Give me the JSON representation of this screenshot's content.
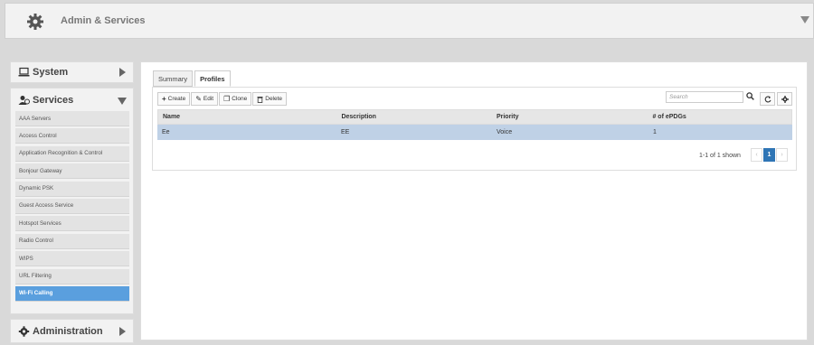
{
  "header": {
    "title": "Admin & Services",
    "icon": "gear-icon"
  },
  "sidebar": {
    "system_label": "System",
    "services_label": "Services",
    "administration_label": "Administration",
    "services_items": [
      {
        "label": "AAA Servers"
      },
      {
        "label": "Access Control"
      },
      {
        "label": "Application Recognition & Control"
      },
      {
        "label": "Bonjour Gateway"
      },
      {
        "label": "Dynamic PSK"
      },
      {
        "label": "Guest Access Service"
      },
      {
        "label": "Hotspot Services"
      },
      {
        "label": "Radio Control"
      },
      {
        "label": "WIPS"
      },
      {
        "label": "URL Filtering"
      },
      {
        "label": "Wi-Fi Calling",
        "active": true
      }
    ]
  },
  "main": {
    "tabs": [
      {
        "label": "Summary"
      },
      {
        "label": "Profiles",
        "active": true
      }
    ],
    "toolbar": {
      "create": "Create",
      "edit": "Edit",
      "clone": "Clone",
      "delete": "Delete"
    },
    "search": {
      "placeholder": "Search"
    },
    "table": {
      "columns": [
        "Name",
        "Description",
        "Priority",
        "# of ePDGs"
      ],
      "rows": [
        [
          "Ee",
          "EE",
          "Voice",
          "1"
        ]
      ]
    },
    "pagination": {
      "shown": "1-1 of 1 shown",
      "prev": "‹",
      "current": "1",
      "next": "›"
    }
  },
  "colors": {
    "active_blue": "#5a9fde",
    "page_blue": "#2f75b5",
    "selected_row": "#bfd1e6"
  }
}
